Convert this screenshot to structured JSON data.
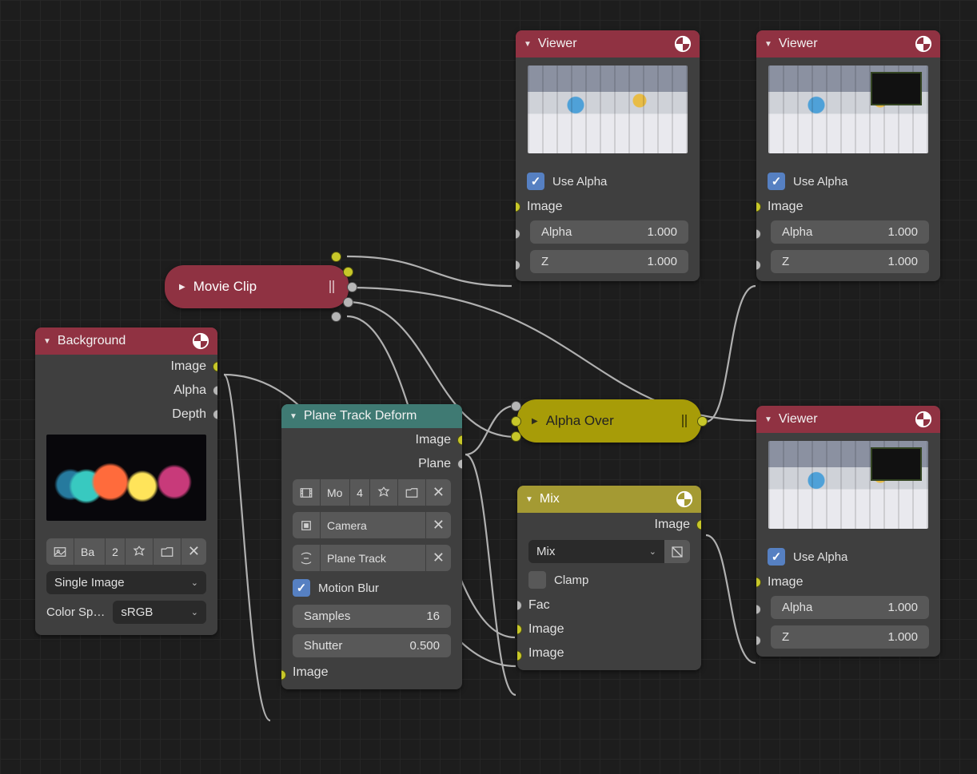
{
  "nodes": {
    "viewer_a": {
      "title": "Viewer",
      "use_alpha": "Use Alpha",
      "image_sock": "Image",
      "alpha_label": "Alpha",
      "alpha_val": "1.000",
      "z_label": "Z",
      "z_val": "1.000"
    },
    "viewer_b": {
      "title": "Viewer",
      "use_alpha": "Use Alpha",
      "image_sock": "Image",
      "alpha_label": "Alpha",
      "alpha_val": "1.000",
      "z_label": "Z",
      "z_val": "1.000"
    },
    "viewer_c": {
      "title": "Viewer",
      "use_alpha": "Use Alpha",
      "image_sock": "Image",
      "alpha_label": "Alpha",
      "alpha_val": "1.000",
      "z_label": "Z",
      "z_val": "1.000"
    },
    "movieclip": {
      "title": "Movie Clip"
    },
    "alphaover": {
      "title": "Alpha Over"
    },
    "background": {
      "title": "Background",
      "out_image": "Image",
      "out_alpha": "Alpha",
      "out_depth": "Depth",
      "file_short": "Ba",
      "users": "2",
      "source": "Single Image",
      "colorspace_label": "Color Sp…",
      "colorspace": "sRGB"
    },
    "planetrack": {
      "title": "Plane Track Deform",
      "out_image": "Image",
      "out_plane": "Plane",
      "clip_short": "Mo",
      "users": "4",
      "object": "Camera",
      "track": "Plane Track",
      "motion_blur": "Motion Blur",
      "samples_label": "Samples",
      "samples_val": "16",
      "shutter_label": "Shutter",
      "shutter_val": "0.500",
      "in_image": "Image"
    },
    "mix": {
      "title": "Mix",
      "out_image": "Image",
      "blend": "Mix",
      "clamp": "Clamp",
      "fac": "Fac",
      "image1": "Image",
      "image2": "Image"
    }
  }
}
